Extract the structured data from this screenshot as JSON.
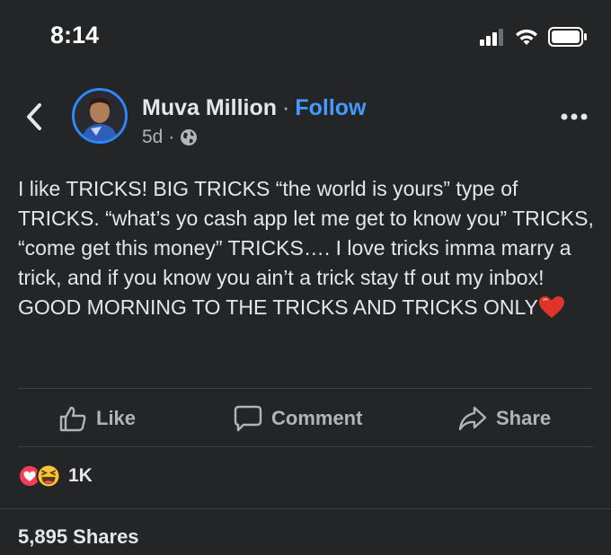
{
  "status_bar": {
    "time": "8:14",
    "icons": [
      "cellular-signal-icon",
      "wifi-icon",
      "battery-icon"
    ]
  },
  "header": {
    "author_name": "Muva Million",
    "separator": "·",
    "follow_label": "Follow",
    "post_age": "5d",
    "meta_separator": "·",
    "privacy_icon": "globe-icon",
    "back_icon": "chevron-left-icon",
    "more_icon": "more-horizontal-icon"
  },
  "post": {
    "text": "I like TRICKS! BIG TRICKS “the world is yours” type of TRICKS. “what’s yo cash app let me get to know you” TRICKS, “come get this money” TRICKS…. I love tricks imma marry a trick, and if you know you ain’t a trick stay tf out my inbox! GOOD MORNING TO THE TRICKS AND TRICKS ONLY",
    "trailing_emoji": "red-heart-icon"
  },
  "actions": {
    "like_label": "Like",
    "comment_label": "Comment",
    "share_label": "Share"
  },
  "reactions": {
    "types": [
      "love-reaction-icon",
      "haha-reaction-icon"
    ],
    "count": "1K"
  },
  "shares": {
    "label": "5,895 Shares"
  },
  "colors": {
    "background": "#242526",
    "text": "#e4e6eb",
    "secondary_text": "#b0b3b8",
    "follow_blue": "#4599ff",
    "avatar_ring": "#2d88ff"
  }
}
